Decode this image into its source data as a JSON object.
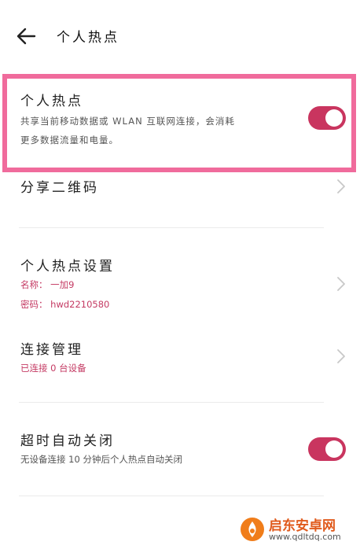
{
  "header": {
    "title": "个人热点"
  },
  "hotspot": {
    "title": "个人热点",
    "description_line1": "共享当前移动数据或 WLAN 互联网连接，会消耗",
    "description_line2": "更多数据流量和电量。",
    "enabled": true
  },
  "share_qr": {
    "title": "分享二维码"
  },
  "hotspot_settings": {
    "title": "个人热点设置",
    "name_line": "名称： 一加9",
    "password_line": "密码： hwd2210580"
  },
  "connection_mgmt": {
    "title": "连接管理",
    "status": "已连接 0 台设备"
  },
  "auto_off": {
    "title": "超时自动关闭",
    "description": "无设备连接 10 分钟后个人热点自动关闭",
    "enabled": true
  },
  "watermark": {
    "brand": "启东安卓网",
    "url": "www.qdltdq.com"
  },
  "colors": {
    "accent": "#c9355f",
    "highlight": "#f06b9c",
    "subtext_pink": "#c43a63"
  },
  "icons": {
    "back": "arrow-left-icon",
    "chevron": "chevron-right-icon"
  }
}
